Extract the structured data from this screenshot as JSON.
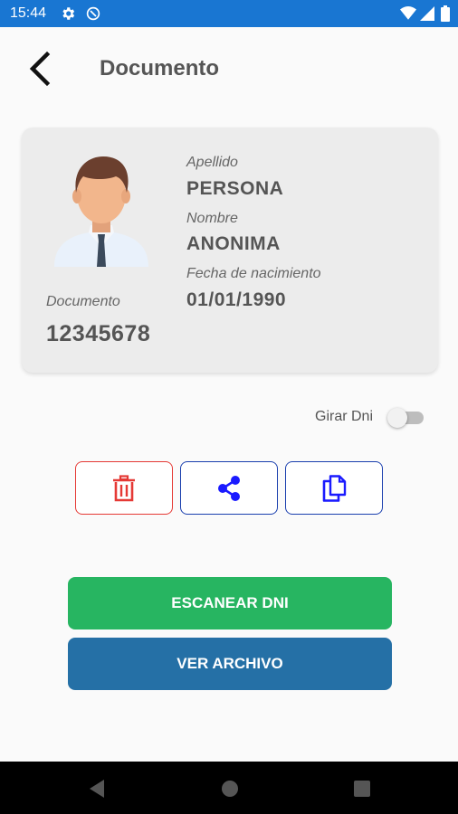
{
  "status_bar": {
    "time": "15:44",
    "icons": [
      "gear-icon",
      "sync-disabled-icon",
      "wifi-icon",
      "signal-icon",
      "battery-icon"
    ]
  },
  "header": {
    "title": "Documento",
    "back_icon": "back-arrow-icon"
  },
  "card": {
    "apellido_label": "Apellido",
    "apellido_value": "PERSONA",
    "nombre_label": "Nombre",
    "nombre_value": "ANONIMA",
    "fecha_label": "Fecha de nacimiento",
    "fecha_value": "01/01/1990",
    "documento_label": "Documento",
    "documento_value": "12345678"
  },
  "toggle": {
    "label": "Girar Dni",
    "checked": false
  },
  "action_buttons": [
    {
      "icon": "trash-icon",
      "color": "#e53935"
    },
    {
      "icon": "share-icon",
      "color": "#1a1aff"
    },
    {
      "icon": "copy-icon",
      "color": "#1a1aff"
    }
  ],
  "buttons": {
    "scan_label": "ESCANEAR DNI",
    "scan_color": "#27b561",
    "archive_label": "VER ARCHIVO",
    "archive_color": "#2570a6"
  },
  "nav_bar": {
    "icons": [
      "nav-back-icon",
      "nav-home-icon",
      "nav-recents-icon"
    ]
  }
}
